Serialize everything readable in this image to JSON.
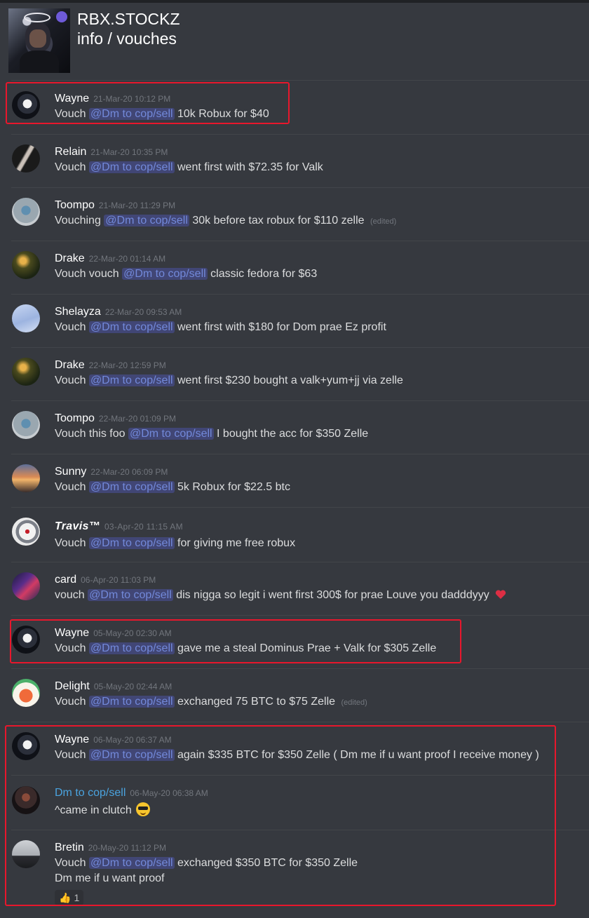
{
  "server": {
    "name": "RBX.STOCKZ",
    "channel": "info / vouches"
  },
  "mention_label": "@Dm to cop/sell",
  "edited_label": "(edited)",
  "messages": [
    {
      "author": "Wayne",
      "time": "21-Mar-20 10:12 PM",
      "prefix": "Vouch",
      "suffix": "10k Robux for $40"
    },
    {
      "author": "Relain",
      "time": "21-Mar-20 10:35 PM",
      "prefix": "Vouch",
      "suffix": "went first with $72.35 for Valk"
    },
    {
      "author": "Toompo",
      "time": "21-Mar-20 11:29 PM",
      "prefix": "Vouching",
      "suffix": "30k before tax robux for $110 zelle"
    },
    {
      "author": "Drake",
      "time": "22-Mar-20 01:14 AM",
      "prefix": "Vouch vouch",
      "suffix": "classic fedora for $63"
    },
    {
      "author": "Shelayza",
      "time": "22-Mar-20 09:53 AM",
      "prefix": "Vouch",
      "suffix": "went first with $180 for Dom prae Ez profit"
    },
    {
      "author": "Drake",
      "time": "22-Mar-20 12:59 PM",
      "prefix": "Vouch",
      "suffix": "went first $230 bought a valk+yum+jj via zelle"
    },
    {
      "author": "Toompo",
      "time": "22-Mar-20 01:09 PM",
      "prefix": "Vouch this foo",
      "suffix": "I bought the acc for $350 Zelle"
    },
    {
      "author": "Sunny",
      "time": "22-Mar-20 06:09 PM",
      "prefix": "Vouch",
      "suffix": "5k Robux for $22.5  btc"
    },
    {
      "author": "Travis™",
      "time": "03-Apr-20 11:15 AM",
      "prefix": "Vouch",
      "suffix": "for giving me free robux"
    },
    {
      "author": "card",
      "time": "06-Apr-20 11:03 PM",
      "prefix": "vouch",
      "suffix": "dis nigga so legit i went first 300$ for prae Louve you dadddyyy"
    },
    {
      "author": "Wayne",
      "time": "05-May-20 02:30 AM",
      "prefix": "Vouch",
      "suffix": "gave me a steal Dominus Prae + Valk for $305 Zelle"
    },
    {
      "author": "Delight",
      "time": "05-May-20 02:44 AM",
      "prefix": "Vouch",
      "suffix": "exchanged 75 BTC to $75 Zelle"
    },
    {
      "author": "Wayne",
      "time": "06-May-20 06:37 AM",
      "prefix": "Vouch",
      "suffix": "again $335 BTC for $350 Zelle ( Dm me if u want proof I receive money )"
    },
    {
      "author": "Dm to cop/sell",
      "time": "06-May-20 06:38 AM",
      "text": "^came in clutch"
    },
    {
      "author": "Bretin",
      "time": "20-May-20 11:12 PM",
      "prefix": "Vouch",
      "suffix": "exchanged $350 BTC for $350 Zelle",
      "line2": "Dm me if u want proof",
      "reaction_count": "1"
    }
  ],
  "icons": {
    "server": "server-icon",
    "heart": "heart-emoji-icon",
    "sunglasses": "sunglasses-emoji-icon",
    "thumbs_up": "thumbs-up-emoji-icon"
  },
  "colors": {
    "background": "#36393f",
    "mention_bg": "#414675",
    "mention_text": "#7289da",
    "highlight_box": "#e8172c",
    "bot_name": "#4aa3df"
  }
}
